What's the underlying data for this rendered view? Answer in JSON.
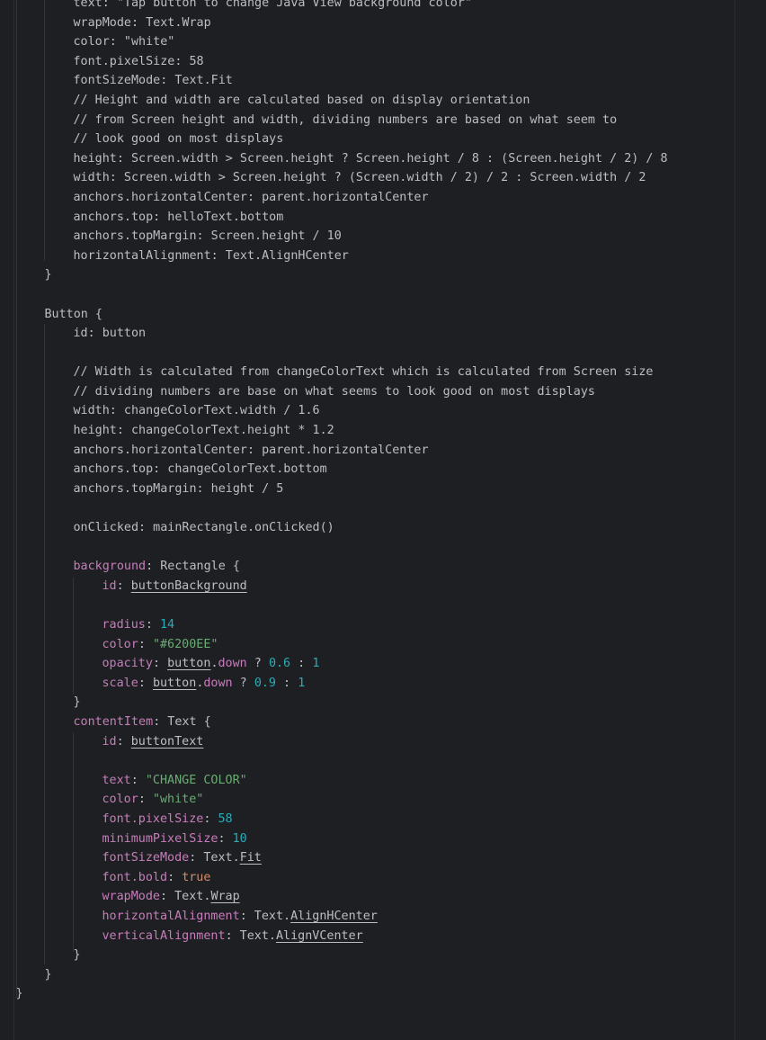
{
  "editor": {
    "language": "QML",
    "lines": [
      {
        "indent": 2,
        "tokens": [
          {
            "t": "text: \"Tap button to change Java View background color\"",
            "k": "plain"
          }
        ]
      },
      {
        "indent": 2,
        "tokens": [
          {
            "t": "wrapMode: Text.Wrap",
            "k": "plain"
          }
        ]
      },
      {
        "indent": 2,
        "tokens": [
          {
            "t": "color: \"white\"",
            "k": "plain"
          }
        ]
      },
      {
        "indent": 2,
        "tokens": [
          {
            "t": "font.pixelSize: 58",
            "k": "plain"
          }
        ]
      },
      {
        "indent": 2,
        "tokens": [
          {
            "t": "fontSizeMode: Text.Fit",
            "k": "plain"
          }
        ]
      },
      {
        "indent": 2,
        "tokens": [
          {
            "t": "// Height and width are calculated based on display orientation",
            "k": "comment"
          }
        ]
      },
      {
        "indent": 2,
        "tokens": [
          {
            "t": "// from Screen height and width, dividing numbers are based on what seem to",
            "k": "comment"
          }
        ]
      },
      {
        "indent": 2,
        "tokens": [
          {
            "t": "// look good on most displays",
            "k": "comment"
          }
        ]
      },
      {
        "indent": 2,
        "tokens": [
          {
            "t": "height: Screen.width > Screen.height ? Screen.height / 8 : (Screen.height / 2) / 8",
            "k": "plain"
          }
        ]
      },
      {
        "indent": 2,
        "tokens": [
          {
            "t": "width: Screen.width > Screen.height ? (Screen.width / 2) / 2 : Screen.width / 2",
            "k": "plain"
          }
        ]
      },
      {
        "indent": 2,
        "tokens": [
          {
            "t": "anchors.horizontalCenter: parent.horizontalCenter",
            "k": "plain"
          }
        ]
      },
      {
        "indent": 2,
        "tokens": [
          {
            "t": "anchors.top: helloText.bottom",
            "k": "plain"
          }
        ]
      },
      {
        "indent": 2,
        "tokens": [
          {
            "t": "anchors.topMargin: Screen.height / 10",
            "k": "plain"
          }
        ]
      },
      {
        "indent": 2,
        "tokens": [
          {
            "t": "horizontalAlignment: Text.AlignHCenter",
            "k": "plain"
          }
        ]
      },
      {
        "indent": 1,
        "tokens": [
          {
            "t": "}",
            "k": "plain"
          }
        ]
      },
      {
        "indent": 0,
        "tokens": []
      },
      {
        "indent": 1,
        "tokens": [
          {
            "t": "Button {",
            "k": "plain"
          }
        ]
      },
      {
        "indent": 2,
        "tokens": [
          {
            "t": "id: button",
            "k": "plain"
          }
        ]
      },
      {
        "indent": 0,
        "tokens": []
      },
      {
        "indent": 2,
        "tokens": [
          {
            "t": "// Width is calculated from changeColorText which is calculated from Screen size",
            "k": "comment"
          }
        ]
      },
      {
        "indent": 2,
        "tokens": [
          {
            "t": "// dividing numbers are base on what seems to look good on most displays",
            "k": "comment"
          }
        ]
      },
      {
        "indent": 2,
        "tokens": [
          {
            "t": "width: changeColorText.width / 1.6",
            "k": "plain"
          }
        ]
      },
      {
        "indent": 2,
        "tokens": [
          {
            "t": "height: changeColorText.height * 1.2",
            "k": "plain"
          }
        ]
      },
      {
        "indent": 2,
        "tokens": [
          {
            "t": "anchors.horizontalCenter: parent.horizontalCenter",
            "k": "plain"
          }
        ]
      },
      {
        "indent": 2,
        "tokens": [
          {
            "t": "anchors.top: changeColorText.bottom",
            "k": "plain"
          }
        ]
      },
      {
        "indent": 2,
        "tokens": [
          {
            "t": "anchors.topMargin: height / 5",
            "k": "plain"
          }
        ]
      },
      {
        "indent": 0,
        "tokens": []
      },
      {
        "indent": 2,
        "tokens": [
          {
            "t": "onClicked: mainRectangle.onClicked()",
            "k": "plain"
          }
        ]
      },
      {
        "indent": 0,
        "tokens": []
      },
      {
        "indent": 2,
        "tokens": [
          {
            "t": "background",
            "k": "prop"
          },
          {
            "t": ": Rectangle {",
            "k": "plain"
          }
        ]
      },
      {
        "indent": 3,
        "tokens": [
          {
            "t": "id",
            "k": "prop"
          },
          {
            "t": ": ",
            "k": "plain"
          },
          {
            "t": "buttonBackground",
            "k": "ulink"
          }
        ]
      },
      {
        "indent": 0,
        "tokens": []
      },
      {
        "indent": 3,
        "tokens": [
          {
            "t": "radius",
            "k": "prop"
          },
          {
            "t": ": ",
            "k": "plain"
          },
          {
            "t": "14",
            "k": "number"
          }
        ]
      },
      {
        "indent": 3,
        "tokens": [
          {
            "t": "color",
            "k": "prop"
          },
          {
            "t": ": ",
            "k": "plain"
          },
          {
            "t": "\"#6200EE\"",
            "k": "string"
          }
        ]
      },
      {
        "indent": 3,
        "tokens": [
          {
            "t": "opacity",
            "k": "prop"
          },
          {
            "t": ": ",
            "k": "plain"
          },
          {
            "t": "button",
            "k": "ulink"
          },
          {
            "t": ".",
            "k": "plain"
          },
          {
            "t": "down",
            "k": "prop"
          },
          {
            "t": " ? ",
            "k": "plain"
          },
          {
            "t": "0.6",
            "k": "number"
          },
          {
            "t": " : ",
            "k": "plain"
          },
          {
            "t": "1",
            "k": "number"
          }
        ]
      },
      {
        "indent": 3,
        "tokens": [
          {
            "t": "scale",
            "k": "prop"
          },
          {
            "t": ": ",
            "k": "plain"
          },
          {
            "t": "button",
            "k": "ulink"
          },
          {
            "t": ".",
            "k": "plain"
          },
          {
            "t": "down",
            "k": "prop"
          },
          {
            "t": " ? ",
            "k": "plain"
          },
          {
            "t": "0.9",
            "k": "number"
          },
          {
            "t": " : ",
            "k": "plain"
          },
          {
            "t": "1",
            "k": "number"
          }
        ]
      },
      {
        "indent": 2,
        "tokens": [
          {
            "t": "}",
            "k": "plain"
          }
        ]
      },
      {
        "indent": 2,
        "tokens": [
          {
            "t": "contentItem",
            "k": "prop"
          },
          {
            "t": ": Text {",
            "k": "plain"
          }
        ]
      },
      {
        "indent": 3,
        "tokens": [
          {
            "t": "id",
            "k": "prop"
          },
          {
            "t": ": ",
            "k": "plain"
          },
          {
            "t": "buttonText",
            "k": "ulink"
          }
        ]
      },
      {
        "indent": 0,
        "tokens": []
      },
      {
        "indent": 3,
        "tokens": [
          {
            "t": "text",
            "k": "prop"
          },
          {
            "t": ": ",
            "k": "plain"
          },
          {
            "t": "\"CHANGE COLOR\"",
            "k": "string"
          }
        ]
      },
      {
        "indent": 3,
        "tokens": [
          {
            "t": "color",
            "k": "prop"
          },
          {
            "t": ": ",
            "k": "plain"
          },
          {
            "t": "\"white\"",
            "k": "string"
          }
        ]
      },
      {
        "indent": 3,
        "tokens": [
          {
            "t": "font.pixelSize",
            "k": "prop"
          },
          {
            "t": ": ",
            "k": "plain"
          },
          {
            "t": "58",
            "k": "number"
          }
        ]
      },
      {
        "indent": 3,
        "tokens": [
          {
            "t": "minimumPixelSize",
            "k": "prop"
          },
          {
            "t": ": ",
            "k": "plain"
          },
          {
            "t": "10",
            "k": "number"
          }
        ]
      },
      {
        "indent": 3,
        "tokens": [
          {
            "t": "fontSizeMode",
            "k": "prop"
          },
          {
            "t": ": Text.",
            "k": "plain"
          },
          {
            "t": "Fit",
            "k": "ulink"
          }
        ]
      },
      {
        "indent": 3,
        "tokens": [
          {
            "t": "font.bold",
            "k": "prop"
          },
          {
            "t": ": ",
            "k": "plain"
          },
          {
            "t": "true",
            "k": "keyword"
          }
        ]
      },
      {
        "indent": 3,
        "tokens": [
          {
            "t": "wrapMode",
            "k": "prop"
          },
          {
            "t": ": Text.",
            "k": "plain"
          },
          {
            "t": "Wrap",
            "k": "ulink"
          }
        ]
      },
      {
        "indent": 3,
        "tokens": [
          {
            "t": "horizontalAlignment",
            "k": "prop"
          },
          {
            "t": ": Text.",
            "k": "plain"
          },
          {
            "t": "AlignHCenter",
            "k": "ulink"
          }
        ]
      },
      {
        "indent": 3,
        "tokens": [
          {
            "t": "verticalAlignment",
            "k": "prop"
          },
          {
            "t": ": Text.",
            "k": "plain"
          },
          {
            "t": "AlignVCenter",
            "k": "ulink"
          }
        ]
      },
      {
        "indent": 2,
        "tokens": [
          {
            "t": "}",
            "k": "plain"
          }
        ]
      },
      {
        "indent": 1,
        "tokens": [
          {
            "t": "}",
            "k": "plain"
          }
        ]
      },
      {
        "indent": 0,
        "tokens": [
          {
            "t": "}",
            "k": "plain"
          }
        ]
      }
    ]
  },
  "colors": {
    "background": "#1e1f22",
    "text": "#bcbec4",
    "property": "#c77dbb",
    "string": "#6aab73",
    "number": "#2aacb8",
    "keyword": "#cf8e6d"
  }
}
